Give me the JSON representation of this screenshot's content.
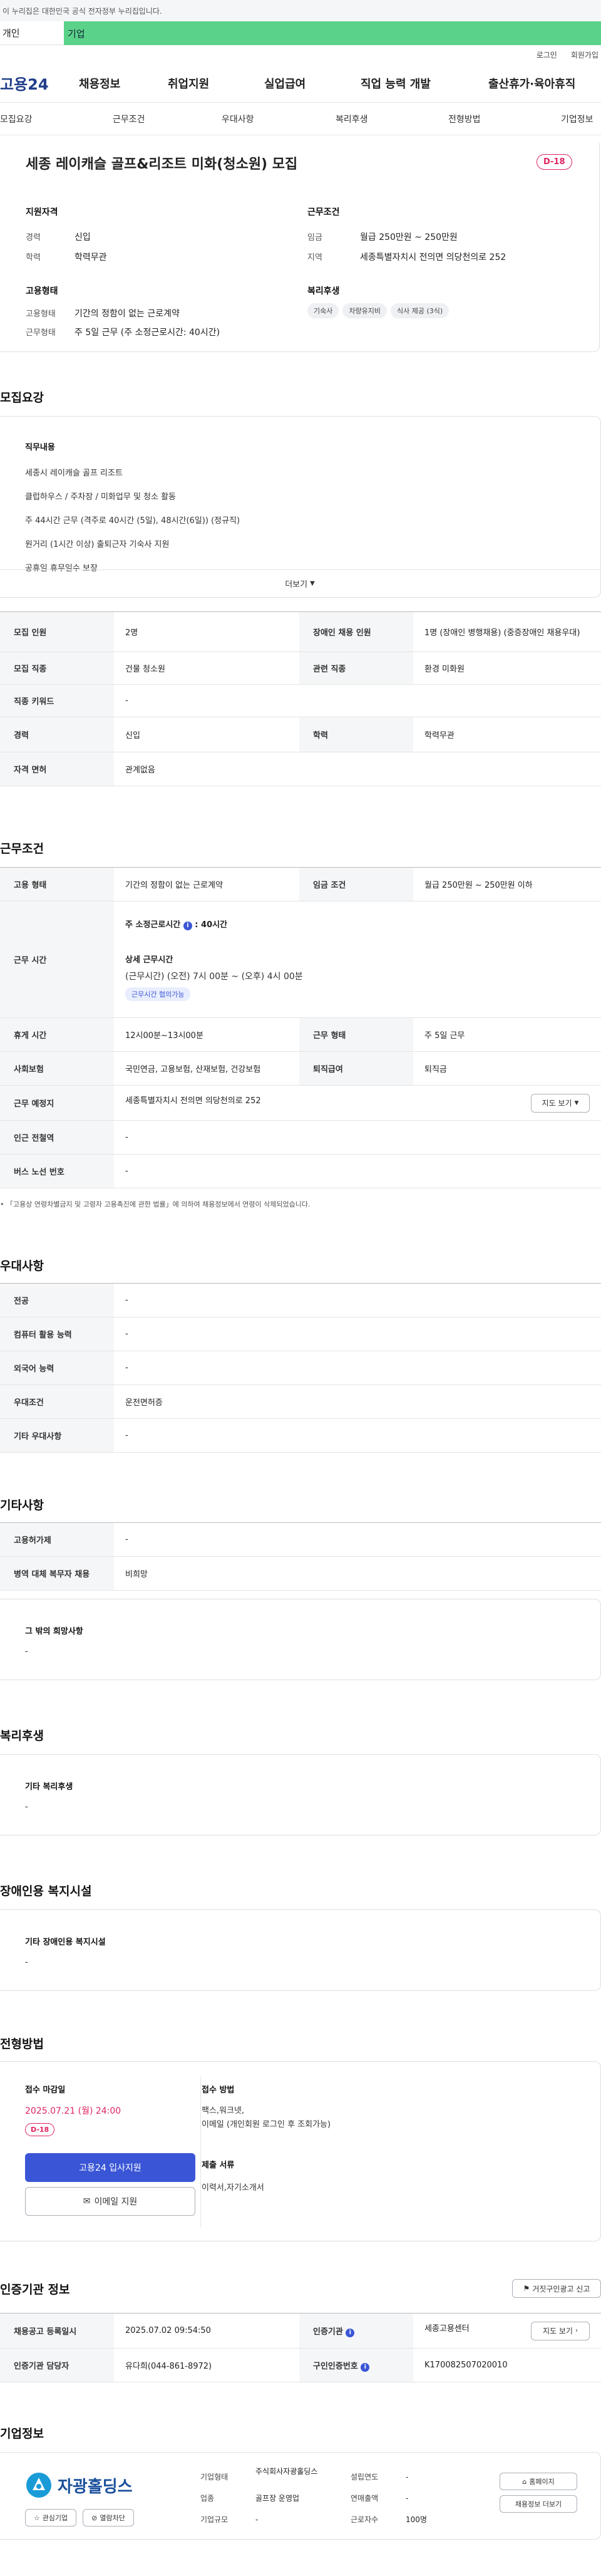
{
  "banner": "이 누리집은 대한민국 공식 전자정부 누리집입니다.",
  "tabs": {
    "person": "개인",
    "corp": "기업"
  },
  "util": {
    "login": "로그인",
    "join": "회원가입"
  },
  "gnb": {
    "logo": "고용24",
    "items": [
      "채용정보",
      "취업지원",
      "실업급여",
      "직업 능력 개발",
      "출산휴가·육아휴직"
    ]
  },
  "subnav": [
    "모집요강",
    "근무조건",
    "우대사항",
    "복리후생",
    "전형방법",
    "기업정보"
  ],
  "job": {
    "title": "세종 레이캐슬 골프&리조트 미화(청소원) 모집",
    "dday": "D-18"
  },
  "summary": {
    "qual_title": "지원자격",
    "cond_title": "근무조건",
    "career_label": "경력",
    "career": "신입",
    "edu_label": "학력",
    "edu": "학력무관",
    "wage_label": "임금",
    "wage": "월급 250만원 ~ 250만원",
    "region_label": "지역",
    "region": "세종특별자치시 전의면 의당천의로 252",
    "emp_title": "고용형태",
    "emp_type_label": "고용형태",
    "emp_type": "기간의 정함이 없는 근로계약",
    "work_form_label": "근무형태",
    "work_form": "주 5일 근무 (주 소정근로시간: 40시간)",
    "welfare_title": "복리후생",
    "welfare_chips": [
      "기숙사",
      "차량유지비",
      "식사 제공 (3식)"
    ]
  },
  "recruit": {
    "section": "모집요강",
    "duty_title": "직무내용",
    "lines": [
      "세종시 레이캐슬 골프 리조트",
      "클럽하우스 / 주차장 / 미화업무 및 청소 활동",
      "주 44시간 근무 (격주로 40시간 (5일), 48시간(6일)) (정규직)",
      "원거리 (1시간 이상) 출퇴근자 기숙사 지원",
      "공휴일 휴무일수 보장"
    ],
    "more": "더보기"
  },
  "recruit_table": [
    [
      "모집 인원",
      "2명",
      "장애인 채용 인원",
      "1명 (장애인 병행채용) (중증장애인 채용우대)"
    ],
    [
      "모집 직종",
      "건물 청소원",
      "관련 직종",
      "환경 미화원"
    ],
    [
      "직종 키워드",
      "-",
      "",
      ""
    ],
    [
      "경력",
      "신입",
      "학력",
      "학력무관"
    ],
    [
      "자격 면허",
      "관계없음",
      "",
      ""
    ]
  ],
  "work": {
    "section": "근무조건",
    "emp_type_label": "고용 형태",
    "emp_type": "기간의 정함이 없는 근로계약",
    "wage_label": "임금 조건",
    "wage": "월급 250만원 ~ 250만원 이하",
    "hours_label": "근무 시간",
    "hours_std": "주 소정근로시간",
    "hours_std_val": "40시간",
    "detail_title": "상세 근무시간",
    "detail": "(근무시간) (오전) 7시 00분 ~ (오후) 4시 00분",
    "detail_badge": "근무시간 협의가능",
    "break_label": "휴게 시간",
    "break": "12시00분~13시00분",
    "form_label": "근무 형태",
    "form": "주 5일 근무",
    "ins_label": "사회보험",
    "ins": "국민연금, 고용보험, 산재보험, 건강보험",
    "retire_label": "퇴직급여",
    "retire": "퇴직금",
    "place_label": "근무 예정지",
    "place": "세종특별자치시 전의면 의당천의로 252",
    "map_btn": "지도 보기",
    "subway_label": "인근 전철역",
    "subway": "-",
    "bus_label": "버스 노선 번호",
    "bus": "-",
    "note": "「고용상 연령차별금지 및 고령자 고용촉진에 관한 법률」에 의하여 채용정보에서 연령이 삭제되었습니다."
  },
  "prefer": {
    "section": "우대사항",
    "rows": [
      [
        "전공",
        "-"
      ],
      [
        "컴퓨터 활용 능력",
        "-"
      ],
      [
        "외국어 능력",
        "-"
      ],
      [
        "우대조건",
        "운전면허증"
      ],
      [
        "기타 우대사항",
        "-"
      ]
    ]
  },
  "etc": {
    "section": "기타사항",
    "rows": [
      [
        "고용허가제",
        "-"
      ],
      [
        "병역 대체 복무자 채용",
        "비희망"
      ]
    ],
    "card_title": "그 밖의 희망사항",
    "card_val": "-"
  },
  "welfare": {
    "section": "복리후생",
    "card_title": "기타 복리후생",
    "card_val": "-"
  },
  "disab": {
    "section": "장애인용 복지시설",
    "card_title": "기타 장애인용 복지시설",
    "card_val": "-"
  },
  "screen": {
    "section": "전형방법",
    "deadline_label": "접수 마감일",
    "deadline": "2025.07.21 (월) 24:00",
    "dday": "D-18",
    "apply_btn": "고용24 입사지원",
    "email_btn": "이메일 지원",
    "method_label": "접수 방법",
    "method1": "팩스,워크넷,",
    "method2": "이메일 (개인회원 로그인 후 조회가능)",
    "docs_label": "제출 서류",
    "docs": "이력서,자기소개서"
  },
  "agency": {
    "section": "인증기관 정보",
    "report_btn": "거짓구인광고 신고",
    "r1": [
      "채용공고 등록일시",
      "2025.07.02 09:54:50",
      "인증기관",
      "세종고용센터"
    ],
    "map_btn": "지도 보기",
    "r2": [
      "인증기관 담당자",
      "유다희(044-861-8972)",
      "구인인증번호",
      "K170082507020010"
    ]
  },
  "company": {
    "section": "기업정보",
    "name": "자광홀딩스",
    "fav_btn": "관심기업",
    "hide_btn": "열람차단",
    "type_label": "기업형태",
    "type": "주식회사자광홀딩스",
    "industry_label": "업종",
    "industry": "골프장 운영업",
    "size_label": "기업규모",
    "size": "-",
    "est_label": "설립연도",
    "est": "-",
    "sales_label": "연매출액",
    "sales": "-",
    "emp_label": "근로자수",
    "emp": "100명",
    "home_btn": "홈페이지",
    "jobs_btn": "채용정보 더보기"
  }
}
